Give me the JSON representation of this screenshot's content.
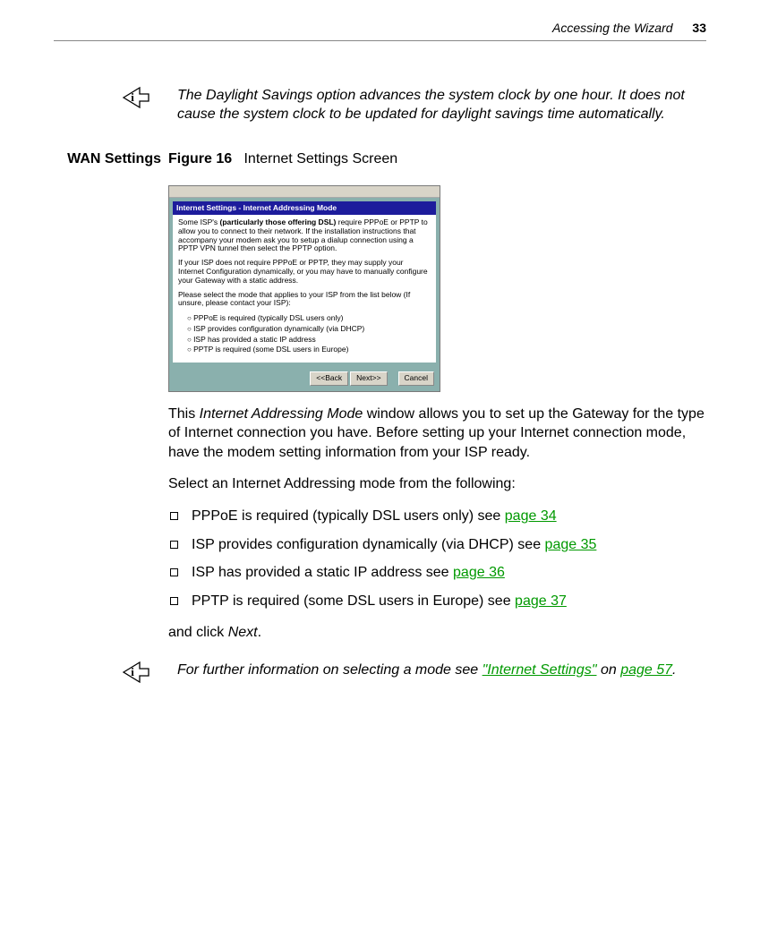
{
  "header": {
    "section": "Accessing the Wizard",
    "page_number": "33"
  },
  "note1": {
    "text": "The Daylight Savings option advances the system clock by one hour. It does not cause the system clock to be updated for daylight savings time automatically."
  },
  "section_heading": "WAN Settings",
  "figure": {
    "label": "Figure 16",
    "title": "Internet Settings Screen"
  },
  "screenshot": {
    "titlebar": "Internet Settings - Internet Addressing Mode",
    "para1_a": "Some ISP's ",
    "para1_bold": "(particularly those offering DSL)",
    "para1_b": " require PPPoE or PPTP to allow you to connect to their network. If the installation instructions that accompany your modem ask you to setup a dialup connection using a PPTP VPN tunnel then select the PPTP option.",
    "para2": "If your ISP does not require PPPoE or PPTP, they may supply your Internet Configuration dynamically, or you may have to manually configure your Gateway with a static address.",
    "para3": "Please select the mode that applies to your ISP from the list below (If unsure, please contact your ISP):",
    "options": [
      "PPPoE is required (typically DSL users only)",
      "ISP provides configuration dynamically (via DHCP)",
      "ISP has provided a static IP address",
      "PPTP is required (some DSL users in Europe)"
    ],
    "buttons": {
      "back": "<<Back",
      "next": "Next>>",
      "cancel": "Cancel"
    }
  },
  "body": {
    "intro_a": "This ",
    "intro_em": "Internet Addressing Mode",
    "intro_b": " window allows you to set up the Gateway for the type of Internet connection you have. Before setting up your Internet connection mode, have the modem setting information from your ISP ready.",
    "select_line": "Select an Internet Addressing mode from the following:",
    "items": [
      {
        "text": "PPPoE is required (typically DSL users only) see ",
        "link": "page 34"
      },
      {
        "text": "ISP provides configuration dynamically (via DHCP) see ",
        "link": "page 35"
      },
      {
        "text": "ISP has provided a static IP address see ",
        "link": "page 36"
      },
      {
        "text": "PPTP is required (some DSL users in Europe) see ",
        "link": "page 37"
      }
    ],
    "closing_a": "and click ",
    "closing_em": "Next",
    "closing_b": "."
  },
  "note2": {
    "pre": "For further information on selecting a mode see ",
    "link": "\"Internet Settings\"",
    "mid": " on ",
    "link2": "page 57",
    "post": "."
  }
}
